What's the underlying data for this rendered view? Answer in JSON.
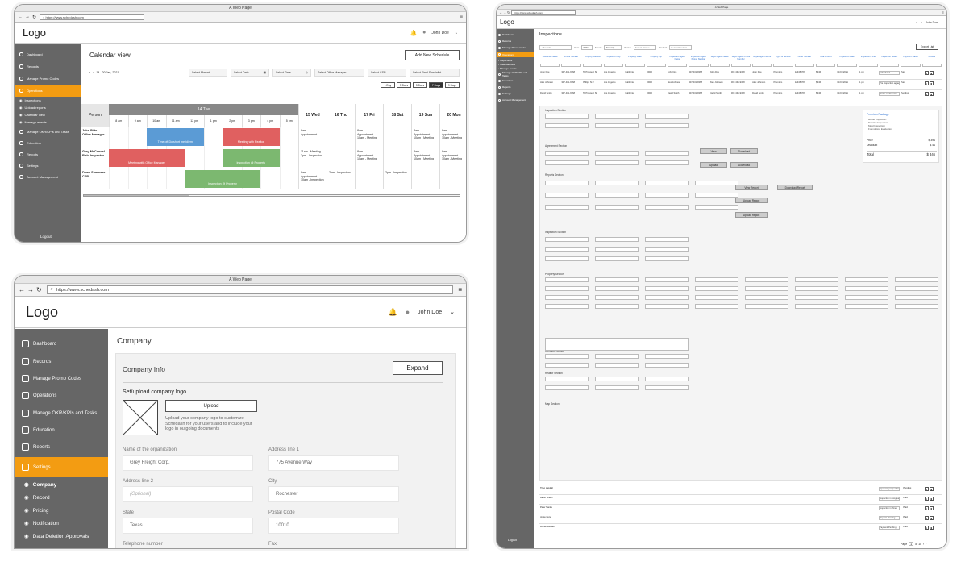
{
  "window_title": "A Web Page",
  "url": "https://www.schedash.com",
  "logo": "Logo",
  "user_name": "John Doe",
  "logout": "Logout",
  "w1": {
    "sidebar": [
      "Dashboard",
      "Records",
      "Manage Promo Codes",
      "Operations"
    ],
    "subnav": [
      "Inspections",
      "Upload reports",
      "Calendar view",
      "Manage events"
    ],
    "sidebar2": [
      "Manage OKR/KPIs and Tasks",
      "Education",
      "Reports",
      "Settings",
      "Account Management"
    ],
    "page_title": "Calendar view",
    "new_btn": "Add New Schedule",
    "date_range": "14 - 20 Jan, 2021",
    "filters": [
      "Select Market",
      "Select Date",
      "Select Time",
      "Select Office Manager",
      "Select CSR",
      "Select Field Specialist"
    ],
    "view_tabs": [
      "1 Day",
      "3 Days",
      "5 Days",
      "7 Days",
      "9 Days"
    ],
    "col_person": "Person",
    "col_today": "14 Tue",
    "hours": [
      "8 am",
      "9 am",
      "10 am",
      "11 am",
      "12 pm",
      "1 pm",
      "2 pm",
      "3 pm",
      "4 pm",
      "5 pm"
    ],
    "days": [
      "15 Wed",
      "16 Thu",
      "17 Fri",
      "18 Sat",
      "19 Sun",
      "20 Mon"
    ],
    "rows": [
      {
        "person": "John Pitts - Office Manager",
        "cells": [
          "8am - Appointment",
          "",
          "8am - Appointment 10am - Meeting",
          "",
          "8am - Appointment 10am - Meeting",
          "8am - Appointment 10am - Meeting"
        ]
      },
      {
        "person": "Grey McConnel - Field Inspector",
        "cells": [
          "11am - Meeting 2pm - Inspection",
          "",
          "8am - Appointment 10am - Meeting",
          "",
          "8am - Appointment 10am - Meeting",
          "8am - Appointment 10am - Meeting"
        ]
      },
      {
        "person": "Dawn Summers - CSR",
        "cells": [
          "8am - Appointment 10am - Inspection",
          "2pm - Inspection",
          "",
          "2pm - Inspection",
          "",
          ""
        ]
      }
    ],
    "events": [
      "Time off Do short meridiem",
      "Meeting with Realtor",
      "Meeting with Office Manager",
      "Inspection @ Property",
      "Inspection @ Property"
    ]
  },
  "w2": {
    "sidebar": [
      "Dashboard",
      "Records",
      "Manage Promo Codes",
      "Operations",
      "Manage OKR/KPIs and Tasks",
      "Education",
      "Reports",
      "Settings"
    ],
    "subnav": [
      "Company",
      "Record",
      "Pricing",
      "Notification",
      "Data Deletion Approvals"
    ],
    "page_title": "Company",
    "section": "Company Info",
    "expand": "Expand",
    "logo_title": "Set/upload company logo",
    "upload": "Upload",
    "upload_help": "Upload your company logo to customize Schedash for your users and to include your logo in outgoing documents",
    "fields": [
      {
        "label": "Name of the organization",
        "value": "Grey Freight Corp."
      },
      {
        "label": "Address line 1",
        "value": "775 Avenue Way"
      },
      {
        "label": "Address line 2",
        "value": "(Optional)"
      },
      {
        "label": "City",
        "value": "Rochester"
      },
      {
        "label": "State",
        "value": "Texas"
      },
      {
        "label": "Postal Code",
        "value": "10010"
      },
      {
        "label": "Telephone number",
        "value": ""
      },
      {
        "label": "Fax",
        "value": ""
      }
    ]
  },
  "w3": {
    "page_title": "Inspections",
    "export": "Export List",
    "search": "Search",
    "year_label": "Year",
    "year": "2021",
    "month_label": "Month",
    "month": "January",
    "status_label": "Status",
    "status": "Select Status",
    "product_label": "Product",
    "product": "Select Product",
    "sidebar": [
      "Dashboard",
      "Records",
      "Manage Promo Codes",
      "Operations",
      "Manage OKR/KPIs and Tasks",
      "Education",
      "Reports",
      "Settings",
      "Account Management"
    ],
    "subnav": [
      "Inspections",
      "Calendar view",
      "Manage events"
    ],
    "columns": [
      "Customer Name",
      "Phone Number",
      "Property Address",
      "Inspection City",
      "Property State",
      "Property Zip",
      "Inspection Agent Name",
      "Inspection Agent Phone Number",
      "Buyer Agent Name",
      "Buyer Agent Phone Number",
      "Buyer Agent Name",
      "Type of Service",
      "Order Number",
      "Total Amount",
      "Inspection Date",
      "Inspection Time",
      "Inspection Status",
      "Payment Status",
      "Actions"
    ],
    "rows": [
      {
        "name": "John Doe",
        "phone": "307-431-9368",
        "addr": "79 Prospect St",
        "city": "Los Angeles",
        "state": "California",
        "zip": "90010",
        "agent": "John Doe",
        "aphone": "307-431-9368",
        "buyer": "John Doe",
        "bphone": "307-431-9368",
        "bname": "John Doe",
        "svc": "Premium",
        "order": "12345678",
        "amt": "$346",
        "date": "01/01/2021",
        "time": "11 pm",
        "status": "Scheduled",
        "pay": "Paid"
      },
      {
        "name": "Alex Johnson",
        "phone": "307-431-9368",
        "addr": "Phillips St 2",
        "city": "Los Angeles",
        "state": "California",
        "zip": "90010",
        "agent": "Alex Johnson",
        "aphone": "307-431-9368",
        "buyer": "Alex Johnson",
        "bphone": "307-431-9368",
        "bname": "Alex Johnson",
        "svc": "Premium",
        "order": "12345678",
        "amt": "$346",
        "date": "01/01/2021",
        "time": "11 pm",
        "status": "Pre Inspection agreement",
        "pay": "Paid"
      },
      {
        "name": "David Smith",
        "phone": "307-431-9368",
        "addr": "79 Prospect St",
        "city": "Los Angeles",
        "state": "California",
        "zip": "90010",
        "agent": "David Smith",
        "aphone": "307-431-9368",
        "buyer": "David Smith",
        "bphone": "307-431-9368",
        "bname": "David Smith",
        "svc": "Premium",
        "order": "12345678",
        "amt": "$346",
        "date": "01/01/2021",
        "time": "11 pm",
        "status": "Order confirmation",
        "pay": "Pending"
      }
    ],
    "bottom_rows": [
      {
        "name": "Theo Hetulah",
        "status": "Upcoming inspection",
        "pay": "Pending"
      },
      {
        "name": "Aaron Green",
        "status": "Inspection in progress",
        "pay": "Paid"
      },
      {
        "name": "Peter Sanka",
        "status": "Inspection in Time",
        "pay": "Paid"
      },
      {
        "name": "Jorge Cena",
        "status": "Reports Pending",
        "pay": "Paid"
      },
      {
        "name": "Hunter Russell",
        "status": "Payment Pending",
        "pay": "Paid"
      }
    ],
    "sections": [
      "Inspection Section",
      "Agreement Section",
      "Reports Section",
      "Inspection Section",
      "Property Section",
      "Contacts Section",
      "Realtor Section",
      "Map Section"
    ],
    "buttons": [
      "View",
      "Download",
      "Upload",
      "Download",
      "View Report",
      "Download Report",
      "Upload Report",
      "Upload Report"
    ],
    "package": {
      "title": "Premium Package",
      "items": [
        "Home inspection",
        "Termite Inspection",
        "Mold Inspection",
        "Foundation Evaluation"
      ],
      "price_label": "Price",
      "price": "$ 391",
      "discount_label": "Discount",
      "discount": "$ 41",
      "total_label": "Total",
      "total": "$ 346"
    },
    "pager": {
      "label": "Page",
      "page": "1",
      "of": "of 10"
    }
  }
}
